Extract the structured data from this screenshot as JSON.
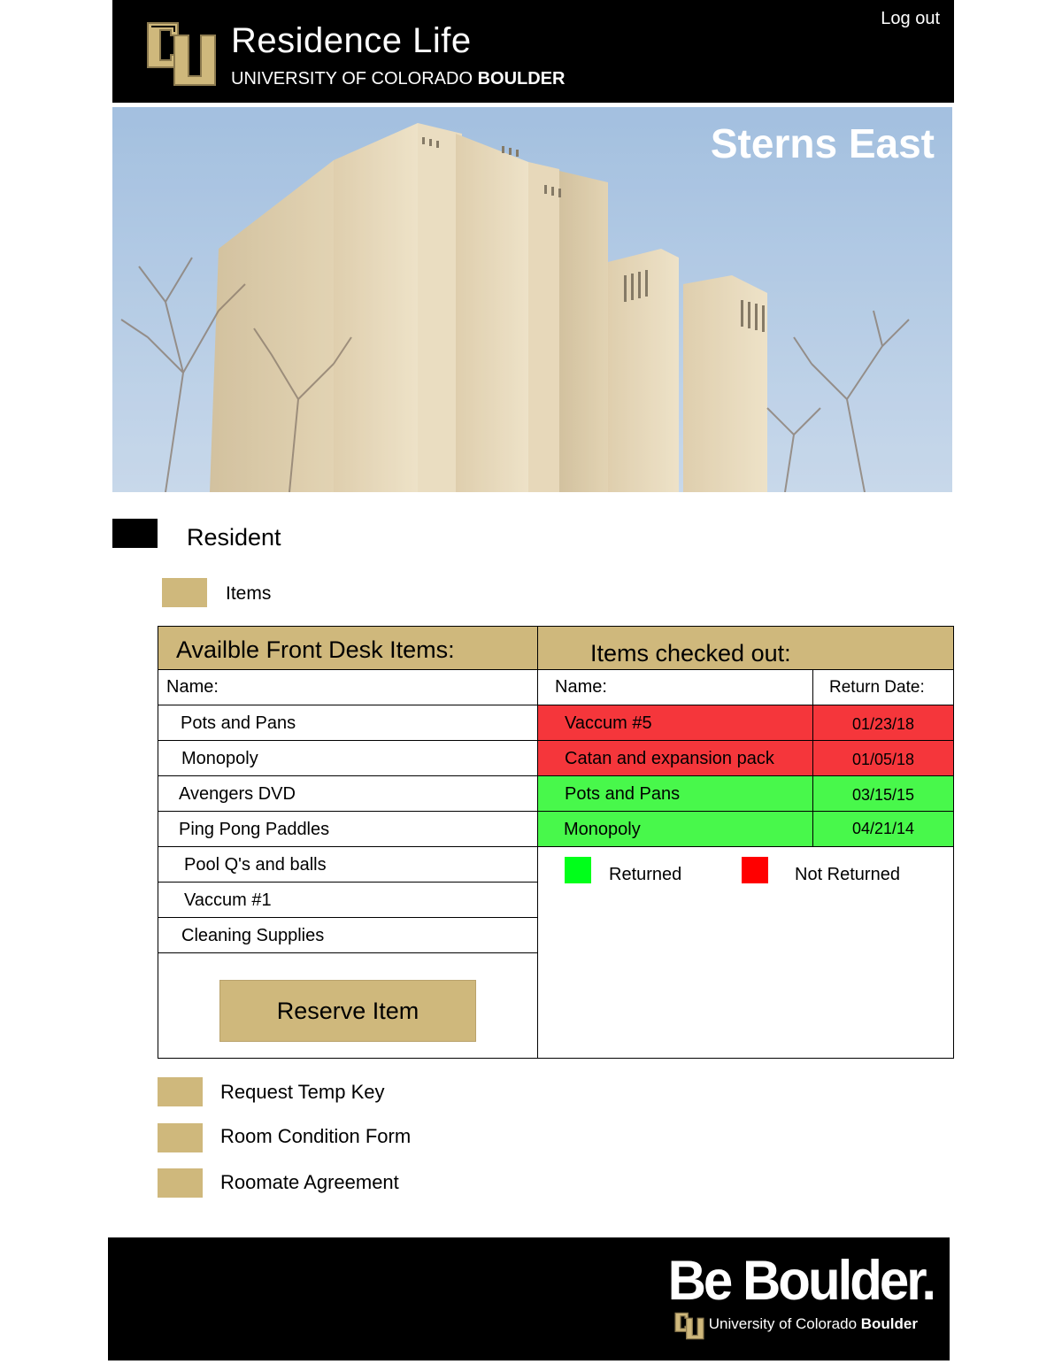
{
  "header": {
    "title": "Residence Life",
    "university_prefix": "UNIVERSITY OF COLORADO",
    "university_bold": "BOULDER",
    "logout_label": "Log out"
  },
  "hero": {
    "building_name": "Sterns East"
  },
  "nav": {
    "resident_label": "Resident",
    "items_label": "Items"
  },
  "available": {
    "heading": "Availble Front Desk Items:",
    "name_header": "Name:",
    "items": [
      "Pots and Pans",
      "Monopoly",
      "Avengers DVD",
      "Ping Pong Paddles",
      "Pool Q's and balls",
      "Vaccum #1",
      "Cleaning Supplies"
    ],
    "reserve_label": "Reserve Item"
  },
  "checked_out": {
    "heading": "Items checked out:",
    "name_header": "Name:",
    "date_header": "Return Date:",
    "rows": [
      {
        "name": "Vaccum #5",
        "date": "01/23/18",
        "status": "not-returned"
      },
      {
        "name": "Catan and expansion pack",
        "date": "01/05/18",
        "status": "not-returned"
      },
      {
        "name": "Pots and Pans",
        "date": "03/15/15",
        "status": "returned"
      },
      {
        "name": "Monopoly",
        "date": "04/21/14",
        "status": "returned"
      }
    ],
    "legend_returned": "Returned",
    "legend_not_returned": "Not Returned",
    "returned_color": "#00ff1a",
    "not_returned_color": "#ff0000"
  },
  "links": {
    "temp_key": "Request Temp Key",
    "room_condition": "Room Condition Form",
    "roommate": "Roomate Agreement"
  },
  "footer": {
    "tagline": "Be Boulder.",
    "university_prefix": "University of Colorado",
    "university_bold": "Boulder"
  },
  "colors": {
    "gold": "#cfb87c",
    "black": "#000000",
    "red_row": "#f5363b",
    "green_row": "#48f84b"
  }
}
